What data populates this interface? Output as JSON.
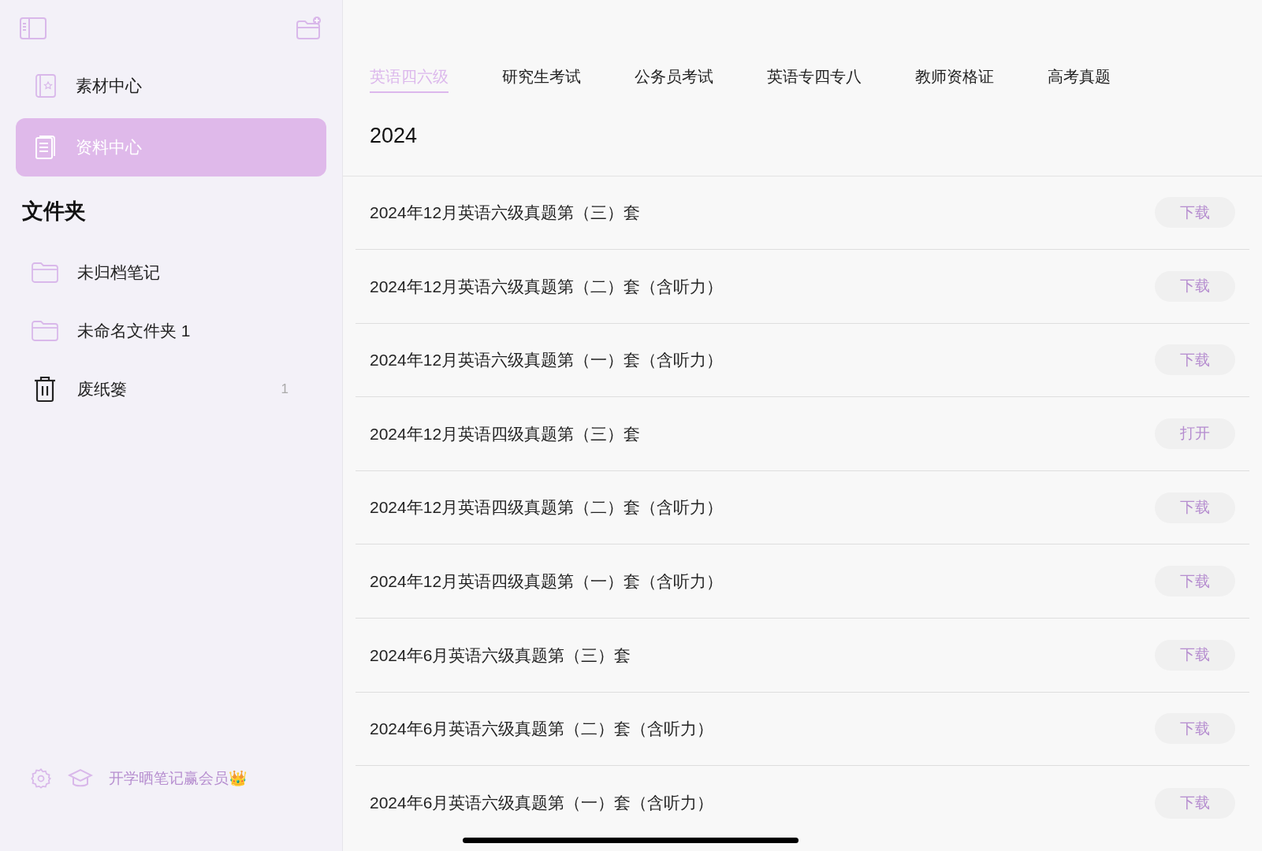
{
  "sidebar": {
    "nav": [
      {
        "label": "素材中心",
        "selected": false
      },
      {
        "label": "资料中心",
        "selected": true
      }
    ],
    "folders_title": "文件夹",
    "folders": [
      {
        "label": "未归档笔记",
        "kind": "folder"
      },
      {
        "label": "未命名文件夹 1",
        "kind": "folder"
      },
      {
        "label": "废纸篓",
        "kind": "trash",
        "count": "1"
      }
    ],
    "promo": "开学晒笔记赢会员👑"
  },
  "tabs": [
    {
      "label": "英语四六级",
      "selected": true
    },
    {
      "label": "研究生考试",
      "selected": false
    },
    {
      "label": "公务员考试",
      "selected": false
    },
    {
      "label": "英语专四专八",
      "selected": false
    },
    {
      "label": "教师资格证",
      "selected": false
    },
    {
      "label": "高考真题",
      "selected": false
    }
  ],
  "year": "2024",
  "rows": [
    {
      "title": "2024年12月英语六级真题第（三）套",
      "action": "下载"
    },
    {
      "title": "2024年12月英语六级真题第（二）套（含听力）",
      "action": "下载"
    },
    {
      "title": "2024年12月英语六级真题第（一）套（含听力）",
      "action": "下载"
    },
    {
      "title": "2024年12月英语四级真题第（三）套",
      "action": "打开"
    },
    {
      "title": "2024年12月英语四级真题第（二）套（含听力）",
      "action": "下载"
    },
    {
      "title": "2024年12月英语四级真题第（一）套（含听力）",
      "action": "下载"
    },
    {
      "title": "2024年6月英语六级真题第（三）套",
      "action": "下载"
    },
    {
      "title": "2024年6月英语六级真题第（二）套（含听力）",
      "action": "下载"
    },
    {
      "title": "2024年6月英语六级真题第（一）套（含听力）",
      "action": "下载"
    }
  ]
}
